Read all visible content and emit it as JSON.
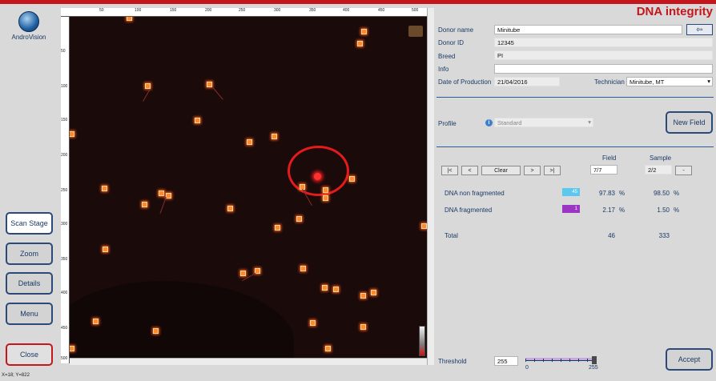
{
  "app": {
    "logo_text": "AndroVision",
    "title": "DNA integrity"
  },
  "left_buttons": {
    "scan_stage": "Scan Stage",
    "zoom": "Zoom",
    "details": "Details",
    "menu": "Menu",
    "close": "Close"
  },
  "viewer": {
    "ruler_top": [
      "50",
      "100",
      "150",
      "200",
      "250",
      "300",
      "350",
      "400",
      "450",
      "500"
    ],
    "ruler_left": [
      "50",
      "100",
      "150",
      "200",
      "250",
      "300",
      "350",
      "400",
      "450",
      "500"
    ],
    "coordinates": "X=18; Y=822"
  },
  "form": {
    "donor_name_label": "Donor name",
    "donor_name": "Minitube",
    "donor_id_label": "Donor ID",
    "donor_id": "12345",
    "breed_label": "Breed",
    "breed": "PI",
    "info_label": "Info",
    "info": "",
    "date_label": "Date of Production",
    "date": "21/04/2016",
    "technician_label": "Technician",
    "technician": "Minitube, MT",
    "profile_label": "Profile",
    "profile": "Standard",
    "new_field": "New Field"
  },
  "results": {
    "field_header": "Field",
    "sample_header": "Sample",
    "nav_first": "|<",
    "nav_prev": "<",
    "clear": "Clear",
    "nav_next": ">",
    "nav_last": ">|",
    "field_value": "7/7",
    "sample_value": "2/2",
    "sample_btn": "-",
    "rows": [
      {
        "label": "DNA non fragmented",
        "count": "45",
        "color": "#5cc8f0",
        "field_pct": "97.83",
        "sample_pct": "98.50",
        "unit": "%"
      },
      {
        "label": "DNA fragmented",
        "count": "1",
        "color": "#9b36c4",
        "field_pct": "2.17",
        "sample_pct": "1.50",
        "unit": "%"
      }
    ],
    "total_label": "Total",
    "total_field": "46",
    "total_sample": "333"
  },
  "threshold": {
    "label": "Threshold",
    "value": "255",
    "min": "0",
    "max": "255"
  },
  "accept": "Accept"
}
